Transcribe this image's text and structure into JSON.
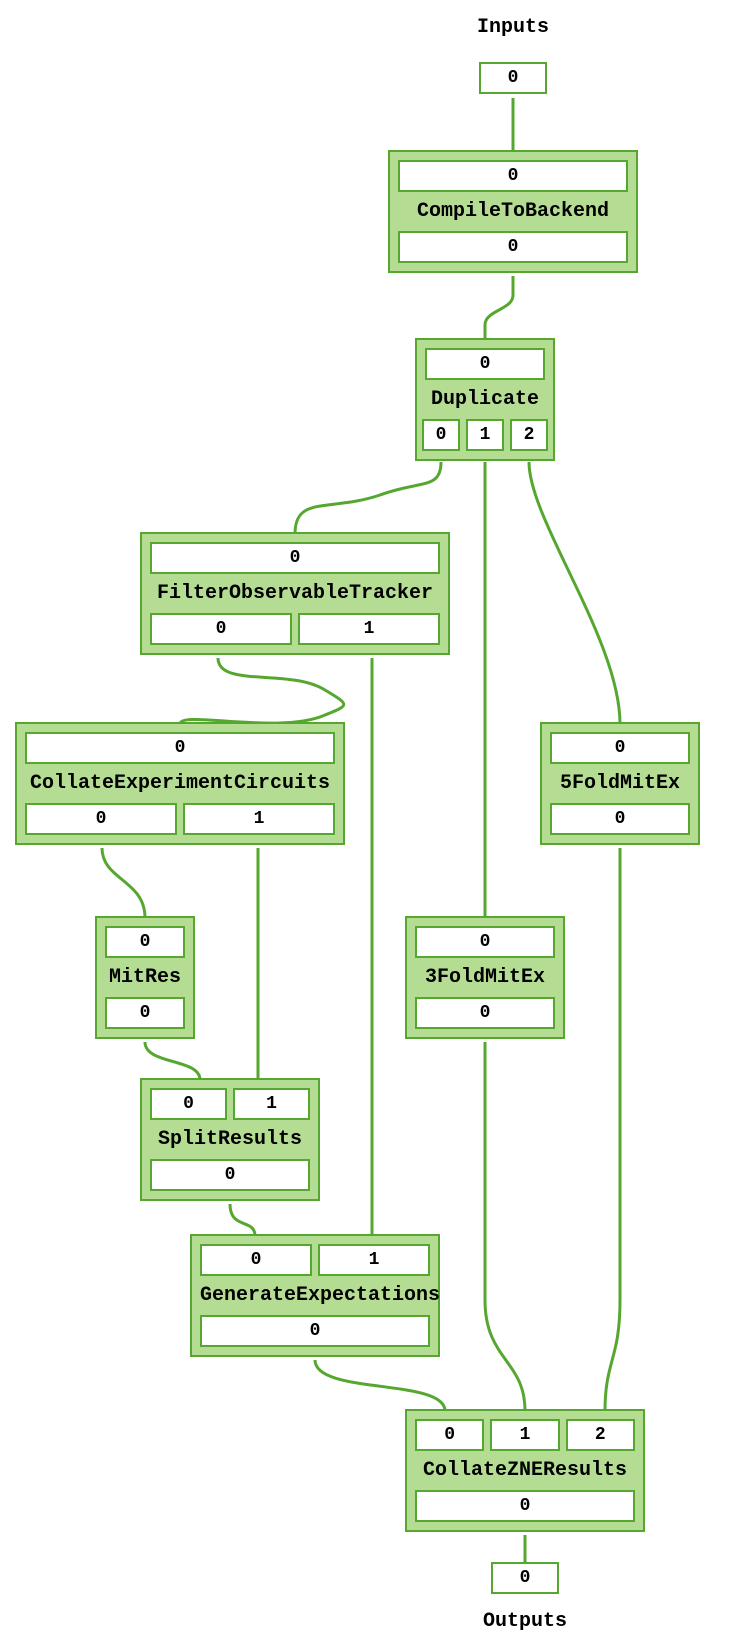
{
  "title_inputs": "Inputs",
  "title_outputs": "Outputs",
  "input_port": "0",
  "output_port": "0",
  "nodes": {
    "compile": {
      "label": "CompileToBackend",
      "in": [
        "0"
      ],
      "out": [
        "0"
      ]
    },
    "duplicate": {
      "label": "Duplicate",
      "in": [
        "0"
      ],
      "out": [
        "0",
        "1",
        "2"
      ]
    },
    "filter": {
      "label": "FilterObservableTracker",
      "in": [
        "0"
      ],
      "out": [
        "0",
        "1"
      ]
    },
    "collateExp": {
      "label": "CollateExperimentCircuits",
      "in": [
        "0"
      ],
      "out": [
        "0",
        "1"
      ]
    },
    "fold5": {
      "label": "5FoldMitEx",
      "in": [
        "0"
      ],
      "out": [
        "0"
      ]
    },
    "mitres": {
      "label": "MitRes",
      "in": [
        "0"
      ],
      "out": [
        "0"
      ]
    },
    "fold3": {
      "label": "3FoldMitEx",
      "in": [
        "0"
      ],
      "out": [
        "0"
      ]
    },
    "split": {
      "label": "SplitResults",
      "in": [
        "0",
        "1"
      ],
      "out": [
        "0"
      ]
    },
    "genexp": {
      "label": "GenerateExpectations",
      "in": [
        "0",
        "1"
      ],
      "out": [
        "0"
      ]
    },
    "collateZNE": {
      "label": "CollateZNEResults",
      "in": [
        "0",
        "1",
        "2"
      ],
      "out": [
        "0"
      ]
    }
  }
}
